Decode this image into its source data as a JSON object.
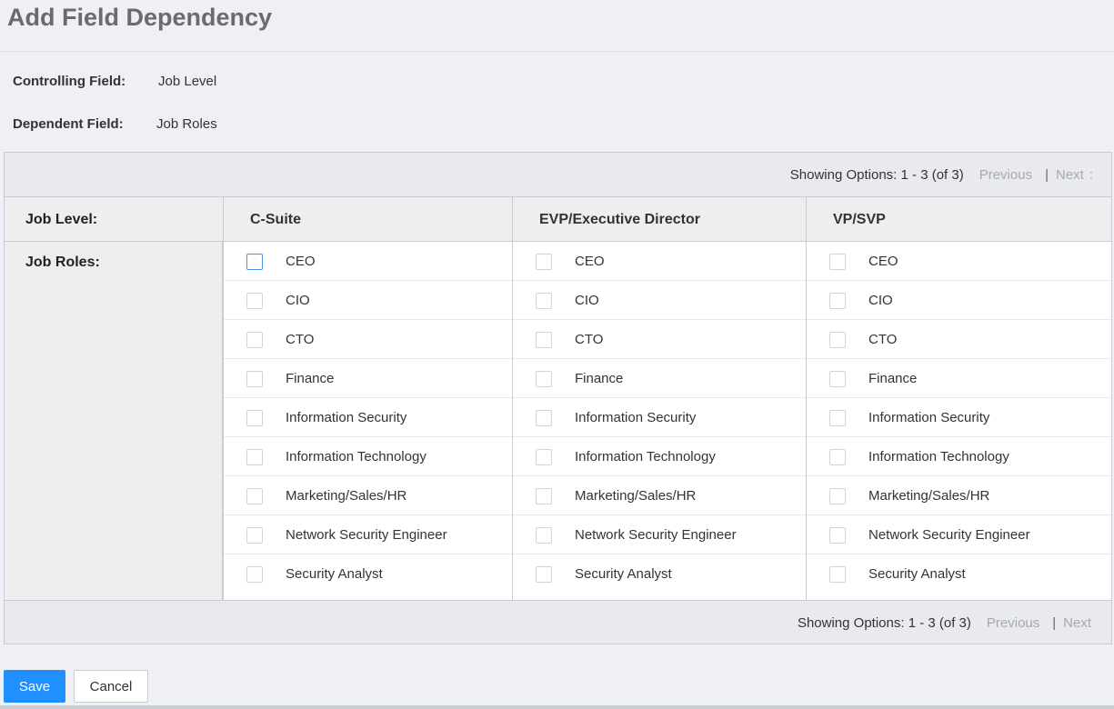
{
  "page": {
    "title": "Add Field Dependency"
  },
  "fields": {
    "controlling_label": "Controlling Field:",
    "controlling_value": "Job Level",
    "dependent_label": "Dependent Field:",
    "dependent_value": "Job Roles"
  },
  "pager_top": {
    "text": "Showing Options: 1 - 3 (of 3)",
    "previous": "Previous",
    "separator": "|",
    "next": "Next",
    "trailing": ":"
  },
  "pager_bottom": {
    "text": "Showing Options: 1 - 3 (of 3)",
    "previous": "Previous",
    "separator": "|",
    "next": "Next"
  },
  "grid": {
    "row_header_level": "Job Level:",
    "row_header_roles": "Job Roles:",
    "columns": [
      {
        "name": "C-Suite",
        "options": [
          "CEO",
          "CIO",
          "CTO",
          "Finance",
          "Information Security",
          "Information Technology",
          "Marketing/Sales/HR",
          "Network Security Engineer",
          "Security Analyst"
        ]
      },
      {
        "name": "EVP/Executive Director",
        "options": [
          "CEO",
          "CIO",
          "CTO",
          "Finance",
          "Information Security",
          "Information Technology",
          "Marketing/Sales/HR",
          "Network Security Engineer",
          "Security Analyst"
        ]
      },
      {
        "name": "VP/SVP",
        "options": [
          "CEO",
          "CIO",
          "CTO",
          "Finance",
          "Information Security",
          "Information Technology",
          "Marketing/Sales/HR",
          "Network Security Engineer",
          "Security Analyst"
        ]
      }
    ]
  },
  "buttons": {
    "save": "Save",
    "cancel": "Cancel"
  },
  "colors": {
    "primary": "#1e90ff",
    "focus_border": "#4a90e2",
    "muted_link": "#a6a9ae"
  }
}
